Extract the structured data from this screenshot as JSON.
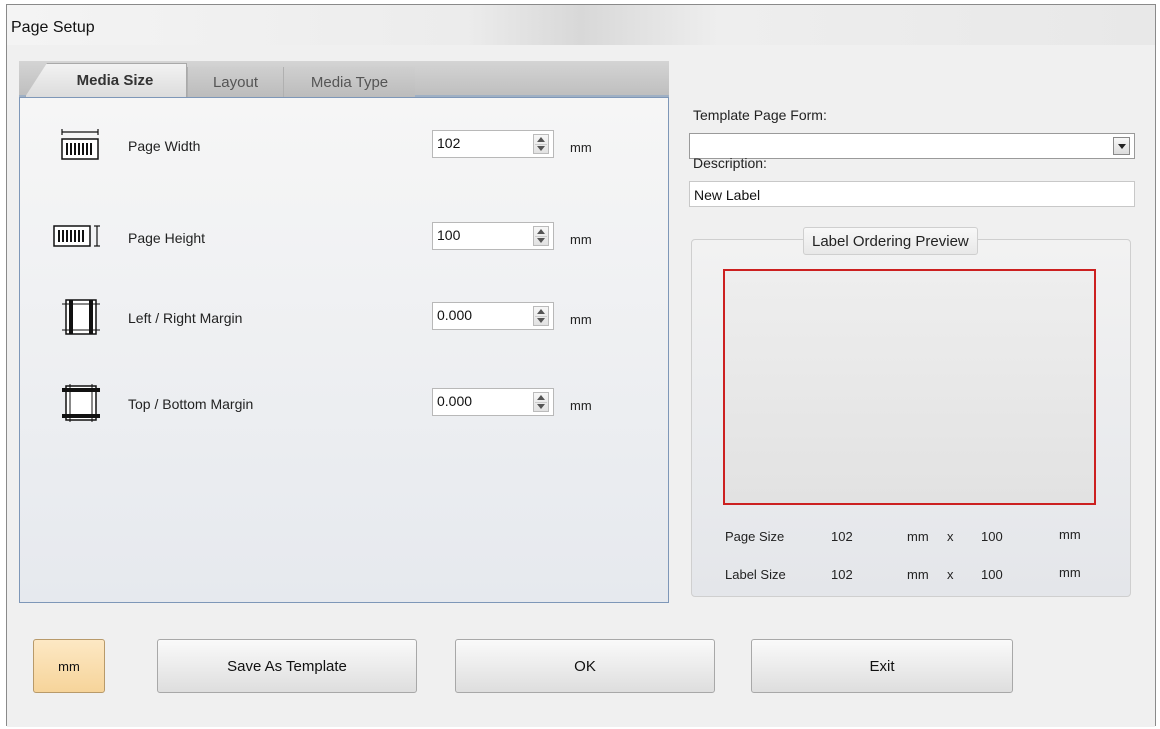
{
  "window": {
    "title": "Page Setup"
  },
  "tabs": [
    {
      "label": "Media Size",
      "active": true
    },
    {
      "label": "Layout",
      "active": false
    },
    {
      "label": "Media Type",
      "active": false
    }
  ],
  "media_size": {
    "rows": [
      {
        "label": "Page Width",
        "value": "102",
        "unit": "mm",
        "icon": "page-width-icon"
      },
      {
        "label": "Page Height",
        "value": "100",
        "unit": "mm",
        "icon": "page-height-icon"
      },
      {
        "label": "Left / Right Margin",
        "value": "0.000",
        "unit": "mm",
        "icon": "left-right-margin-icon"
      },
      {
        "label": "Top / Bottom Margin",
        "value": "0.000",
        "unit": "mm",
        "icon": "top-bottom-margin-icon"
      }
    ]
  },
  "template": {
    "form_label": "Template Page Form:",
    "form_value": "",
    "description_label": "Description:",
    "description_value": "New Label"
  },
  "preview": {
    "title": "Label Ordering Preview",
    "border_color": "#cc2020",
    "page_size": {
      "label": "Page Size",
      "width": "102",
      "w_unit": "mm",
      "x": "x",
      "height": "100",
      "h_unit": "mm"
    },
    "label_size": {
      "label": "Label Size",
      "width": "102",
      "w_unit": "mm",
      "x": "x",
      "height": "100",
      "h_unit": "mm"
    }
  },
  "buttons": {
    "unit": "mm",
    "save_template": "Save As Template",
    "ok": "OK",
    "exit": "Exit"
  },
  "colors": {
    "unit_button_bg": "#f6d49a",
    "panel_border": "#7e97b8"
  }
}
